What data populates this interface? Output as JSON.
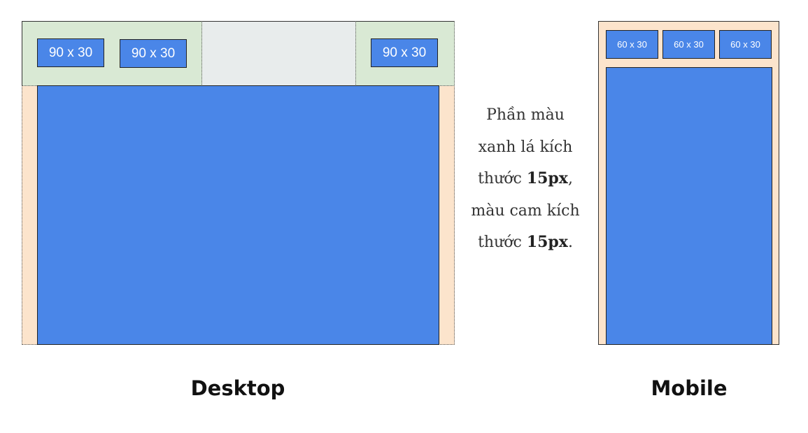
{
  "desktop": {
    "buttons": [
      "90 x 30",
      "90 x 30",
      "90 x 30"
    ],
    "caption": "Desktop"
  },
  "mobile": {
    "buttons": [
      "60 x 30",
      "60 x 30",
      "60 x 30"
    ],
    "caption": "Mobile"
  },
  "note": {
    "line1": "Phần màu",
    "line2": "xanh lá kích",
    "line3_prefix": "thước ",
    "line3_bold": "15px",
    "line3_suffix": ",",
    "line4": "màu cam kích",
    "line5_prefix": "thước ",
    "line5_bold": "15px",
    "line5_suffix": "."
  },
  "colors": {
    "green_area": "#d9e9d4",
    "orange_area": "#fce4cc",
    "gray_area": "#e8ecec",
    "blue_block": "#4a86e8"
  }
}
